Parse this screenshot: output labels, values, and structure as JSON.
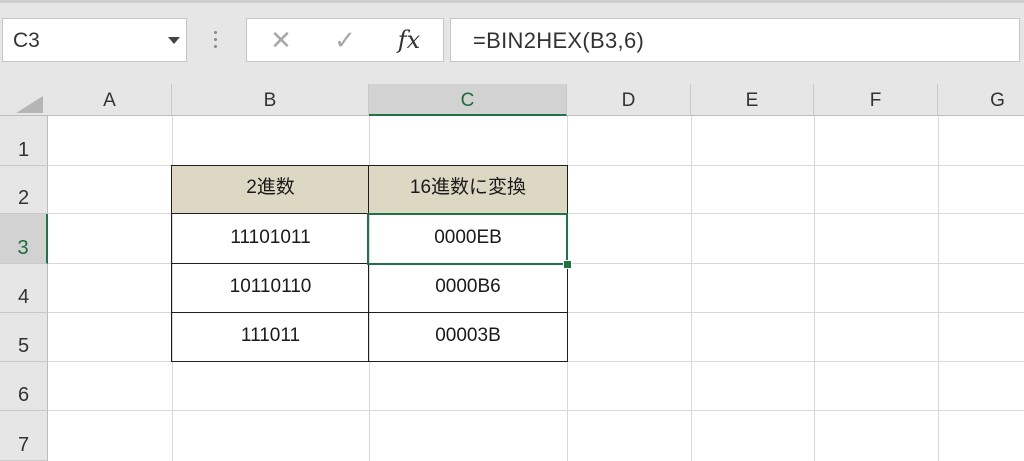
{
  "name_box": "C3",
  "formula": "=BIN2HEX(B3,6)",
  "formula_buttons": {
    "cancel_icon": "✕",
    "enter_icon": "✓",
    "fx_label": "fx"
  },
  "columns": [
    "A",
    "B",
    "C",
    "D",
    "E",
    "F",
    "G"
  ],
  "rows": [
    "1",
    "2",
    "3",
    "4",
    "5",
    "6",
    "7"
  ],
  "table": {
    "header_b": "2進数",
    "header_c": "16進数に変換",
    "rows": [
      {
        "b": "11101011",
        "c": "0000EB"
      },
      {
        "b": "10110110",
        "c": "0000B6"
      },
      {
        "b": "111011",
        "c": "00003B"
      }
    ]
  },
  "colors": {
    "header_fill": "#ddd8c4",
    "selection": "#217346"
  }
}
